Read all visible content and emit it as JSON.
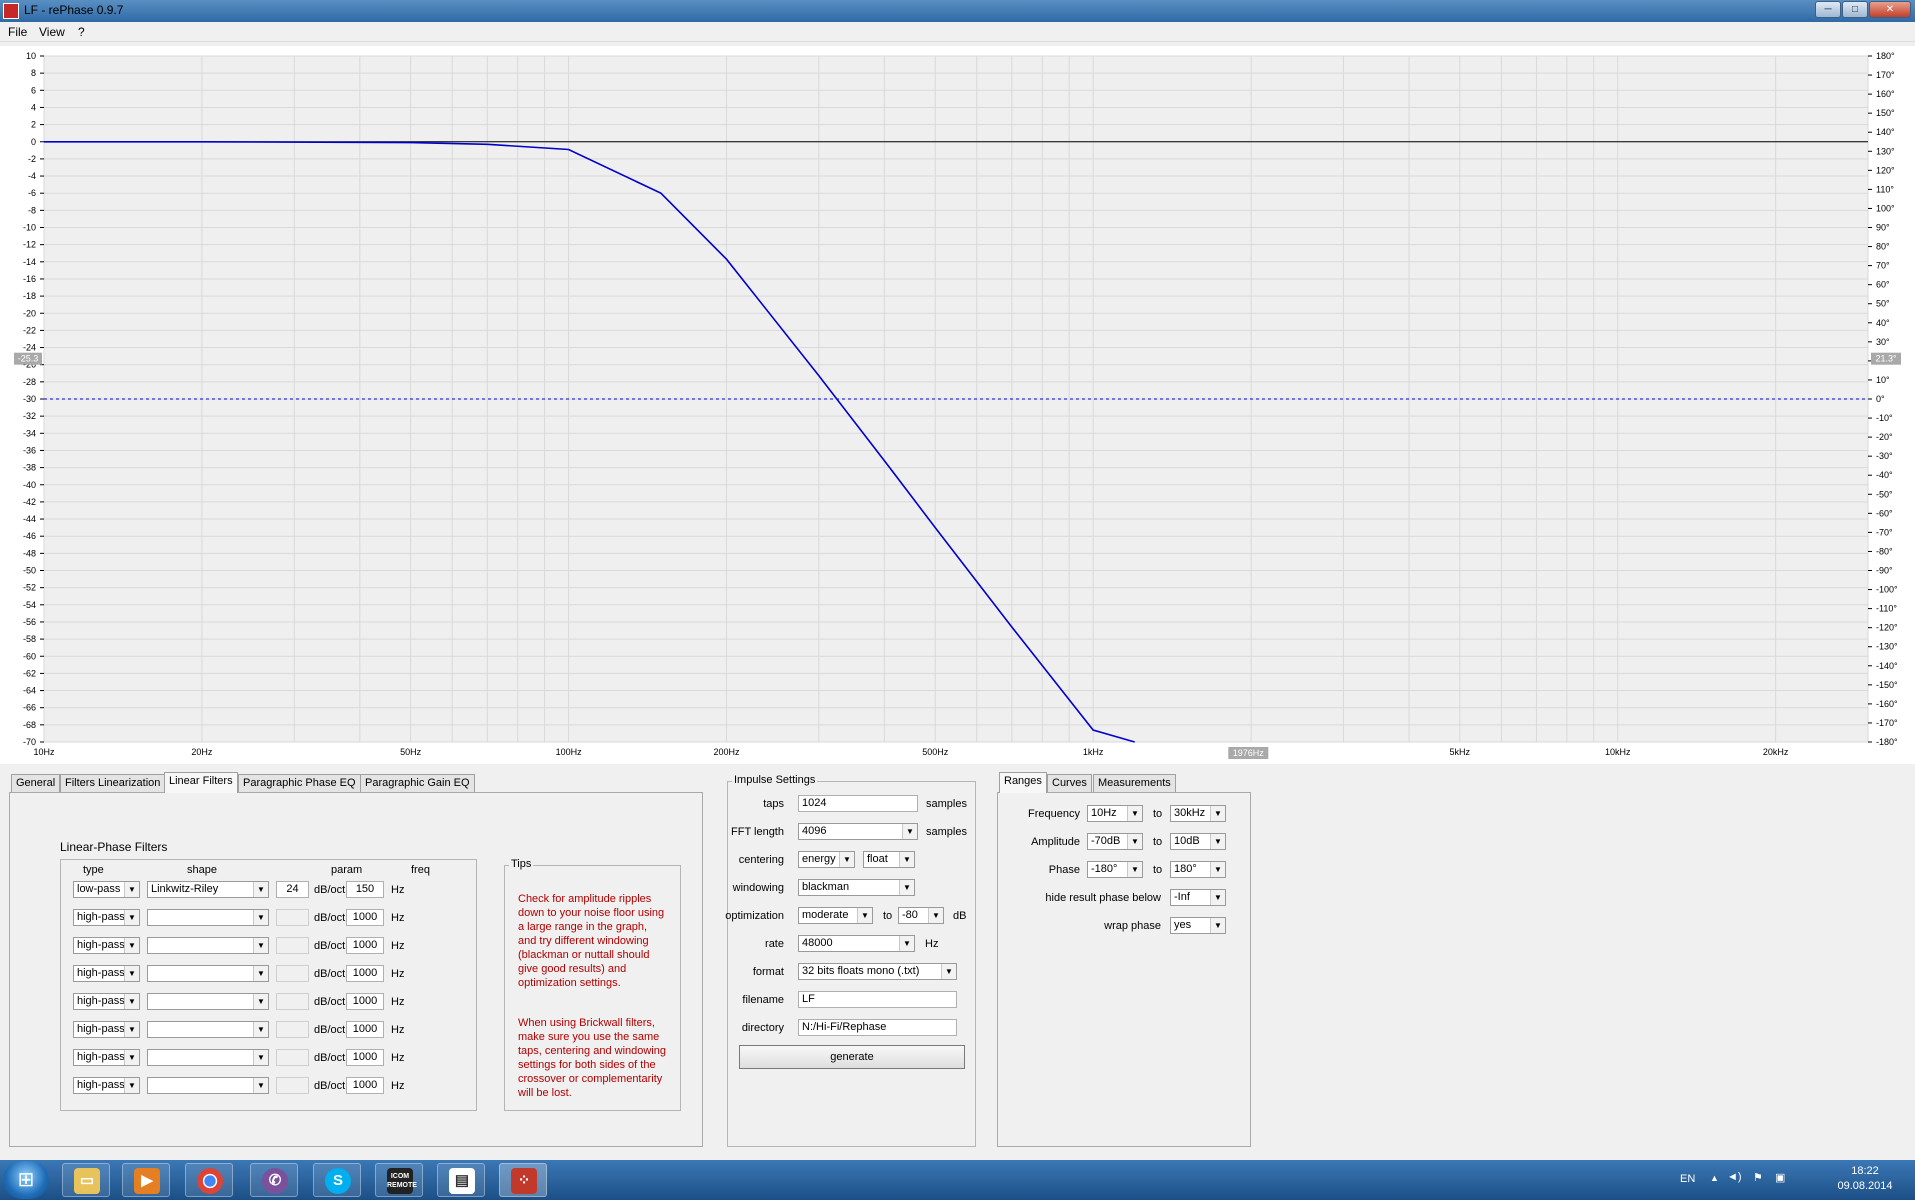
{
  "window": {
    "title": "LF  -  rePhase 0.9.7",
    "min": "─",
    "max": "□",
    "close": "✕"
  },
  "menu": [
    "File",
    "View",
    "?"
  ],
  "graph": {
    "y_left_ticks": [
      "10",
      "8",
      "6",
      "4",
      "2",
      "0",
      "-2",
      "-4",
      "-6",
      "-8",
      "-10",
      "-12",
      "-14",
      "-16",
      "-18",
      "-20",
      "-22",
      "-24",
      "-26",
      "-28",
      "-30",
      "-32",
      "-34",
      "-36",
      "-38",
      "-40",
      "-42",
      "-44",
      "-46",
      "-48",
      "-50",
      "-52",
      "-54",
      "-56",
      "-58",
      "-60",
      "-62",
      "-64",
      "-66",
      "-68",
      "-70"
    ],
    "y_right_ticks": [
      "180°",
      "170°",
      "160°",
      "150°",
      "140°",
      "130°",
      "120°",
      "110°",
      "100°",
      "90°",
      "80°",
      "70°",
      "60°",
      "50°",
      "40°",
      "30°",
      "20°",
      "10°",
      "0°",
      "-10°",
      "-20°",
      "-30°",
      "-40°",
      "-50°",
      "-60°",
      "-70°",
      "-80°",
      "-90°",
      "-100°",
      "-110°",
      "-120°",
      "-130°",
      "-140°",
      "-150°",
      "-160°",
      "-170°",
      "-180°"
    ],
    "x_ticks": [
      {
        "label": "10Hz",
        "f": 10
      },
      {
        "label": "20Hz",
        "f": 20
      },
      {
        "label": "50Hz",
        "f": 50
      },
      {
        "label": "100Hz",
        "f": 100
      },
      {
        "label": "200Hz",
        "f": 200
      },
      {
        "label": "500Hz",
        "f": 500
      },
      {
        "label": "1kHz",
        "f": 1000
      },
      {
        "label": "5kHz",
        "f": 5000
      },
      {
        "label": "10kHz",
        "f": 10000
      },
      {
        "label": "20kHz",
        "f": 20000
      }
    ],
    "cursor_left": "-25.3",
    "cursor_right": "21.3°",
    "cursor_x": "1976Hz",
    "cursor_x_f": 1976,
    "cursor_db": -25.3,
    "x_range": [
      10,
      30000
    ],
    "y_range_db": [
      -70,
      10
    ],
    "curve_color": "#0000c8",
    "phase_line_color": "#0000c8"
  },
  "chart_data": {
    "type": "line",
    "title": "",
    "xlabel": "",
    "ylabel": "",
    "xscale": "log",
    "xlim": [
      10,
      30000
    ],
    "ylim": [
      -70,
      10
    ],
    "y2lim": [
      -180,
      180
    ],
    "series": [
      {
        "filter": "low-pass Linkwitz-Riley 24 dB/oct 150 Hz",
        "x": [
          10,
          20,
          50,
          70,
          100,
          150,
          200,
          300,
          400,
          500,
          700,
          1000,
          1200
        ],
        "y": [
          0,
          0,
          -0.1,
          -0.3,
          -0.9,
          -6,
          -13.7,
          -27.3,
          -37.2,
          -45,
          -56.6,
          -68.6,
          -70
        ]
      },
      {
        "x": [
          10,
          30000
        ],
        "y": [
          0,
          0
        ]
      }
    ]
  },
  "tabs_left": [
    "General",
    "Filters Linearization",
    "Linear Filters",
    "Paragraphic Phase EQ",
    "Paragraphic Gain EQ"
  ],
  "filters": {
    "title": "Linear-Phase Filters",
    "headers": {
      "type": "type",
      "shape": "shape",
      "param": "param",
      "freq": "freq"
    },
    "rows": [
      {
        "type": "low-pass",
        "shape": "Linkwitz-Riley",
        "param": "24",
        "unit": "dB/oct",
        "freq": "150",
        "hz": "Hz"
      },
      {
        "type": "high-pass",
        "shape": "",
        "param": "",
        "unit": "dB/oct",
        "freq": "1000",
        "hz": "Hz"
      },
      {
        "type": "high-pass",
        "shape": "",
        "param": "",
        "unit": "dB/oct",
        "freq": "1000",
        "hz": "Hz"
      },
      {
        "type": "high-pass",
        "shape": "",
        "param": "",
        "unit": "dB/oct",
        "freq": "1000",
        "hz": "Hz"
      },
      {
        "type": "high-pass",
        "shape": "",
        "param": "",
        "unit": "dB/oct",
        "freq": "1000",
        "hz": "Hz"
      },
      {
        "type": "high-pass",
        "shape": "",
        "param": "",
        "unit": "dB/oct",
        "freq": "1000",
        "hz": "Hz"
      },
      {
        "type": "high-pass",
        "shape": "",
        "param": "",
        "unit": "dB/oct",
        "freq": "1000",
        "hz": "Hz"
      },
      {
        "type": "high-pass",
        "shape": "",
        "param": "",
        "unit": "dB/oct",
        "freq": "1000",
        "hz": "Hz"
      }
    ]
  },
  "tips": {
    "title": "Tips",
    "p1": "Check for amplitude ripples down to your noise floor using a large range in the graph, and try different windowing (blackman or nuttall should give good results) and optimization settings.",
    "p2": "When using Brickwall filters, make sure you use the same taps, centering and windowing settings for both sides of the crossover or complementarity will be lost."
  },
  "impulse": {
    "title": "Impulse Settings",
    "taps_label": "taps",
    "taps": "1024",
    "samples": "samples",
    "fft_label": "FFT length",
    "fft": "4096",
    "centering_label": "centering",
    "centering": "energy",
    "centering2": "float",
    "windowing_label": "windowing",
    "windowing": "blackman",
    "optimization_label": "optimization",
    "optimization": "moderate",
    "to": "to",
    "opt_db": "-80",
    "db": "dB",
    "rate_label": "rate",
    "rate": "48000",
    "hz": "Hz",
    "format_label": "format",
    "format": "32 bits floats mono (.txt)",
    "filename_label": "filename",
    "filename": "LF",
    "directory_label": "directory",
    "directory": "N:/Hi-Fi/Rephase",
    "generate": "generate"
  },
  "tabs_right": [
    "Ranges",
    "Curves",
    "Measurements"
  ],
  "ranges": {
    "frequency_label": "Frequency",
    "freq_from": "10Hz",
    "to": "to",
    "freq_to": "30kHz",
    "amplitude_label": "Amplitude",
    "amp_from": "-70dB",
    "amp_to": "10dB",
    "phase_label": "Phase",
    "phase_from": "-180°",
    "phase_to": "180°",
    "hide_label": "hide result phase below",
    "hide": "-Inf",
    "wrap_label": "wrap phase",
    "wrap": "yes"
  },
  "taskbar": {
    "apps": [
      "folder-icon",
      "media-player-icon",
      "chrome-icon",
      "viber-icon",
      "skype-icon",
      "icom-remote-icon",
      "document-icon",
      "rephase-icon"
    ],
    "icom_label": "ICOM REMOTE",
    "lang": "EN",
    "time": "18:22",
    "date": "09.08.2014"
  }
}
